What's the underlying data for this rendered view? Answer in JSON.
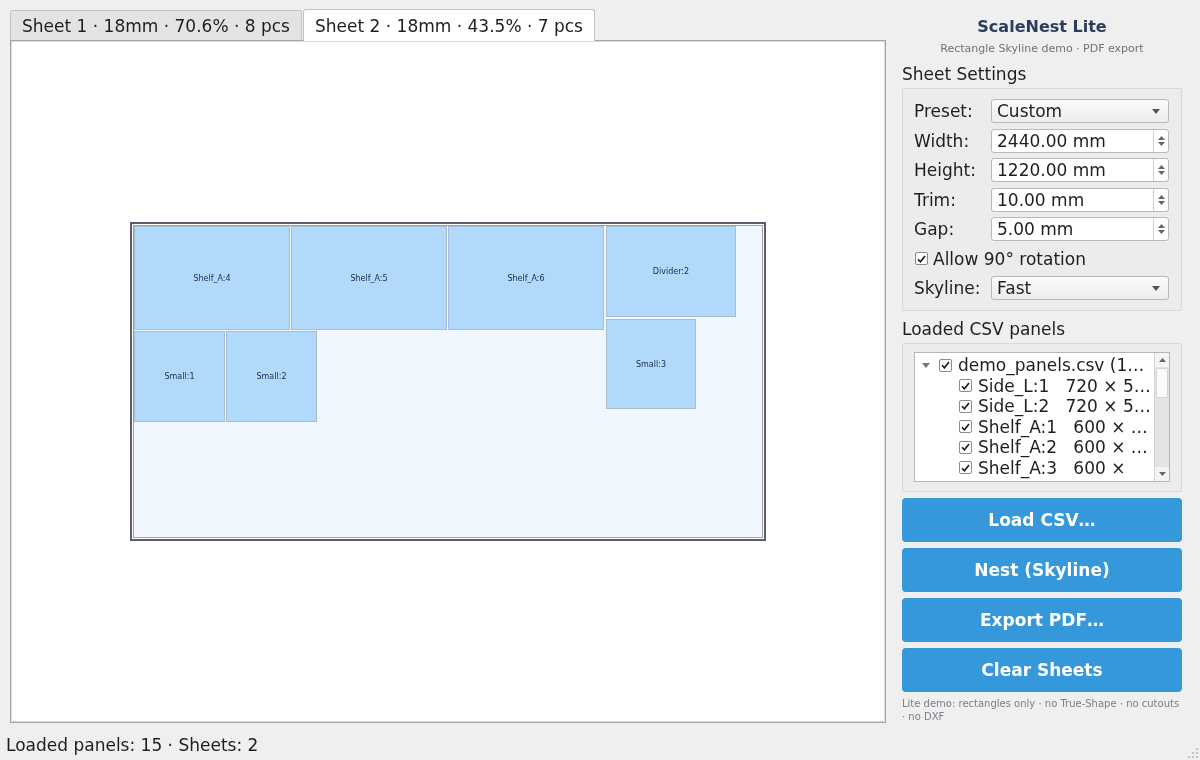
{
  "tabs": [
    {
      "label": "Sheet 1 · 18mm · 70.6% · 8 pcs",
      "selected": false
    },
    {
      "label": "Sheet 2 · 18mm · 43.5% · 7 pcs",
      "selected": true
    }
  ],
  "sheet_view": {
    "pieces": [
      {
        "label": "Shelf_A:4"
      },
      {
        "label": "Shelf_A:5"
      },
      {
        "label": "Shelf_A:6"
      },
      {
        "label": "Divider:2"
      },
      {
        "label": "Small:1"
      },
      {
        "label": "Small:2"
      },
      {
        "label": "Small:3"
      }
    ]
  },
  "header": {
    "title": "ScaleNest Lite",
    "subtitle": "Rectangle Skyline demo · PDF export"
  },
  "sheet_settings": {
    "title": "Sheet Settings",
    "fields": [
      {
        "kind": "dropdown",
        "label": "Preset:",
        "value": "Custom"
      },
      {
        "kind": "spinbox",
        "label": "Width:",
        "value": "2440.00 mm"
      },
      {
        "kind": "spinbox",
        "label": "Height:",
        "value": "1220.00 mm"
      },
      {
        "kind": "spinbox",
        "label": "Trim:",
        "value": "10.00 mm"
      },
      {
        "kind": "spinbox",
        "label": "Gap:",
        "value": "5.00 mm"
      },
      {
        "kind": "checkbox",
        "label": "Allow 90° rotation",
        "checked": true
      },
      {
        "kind": "dropdown",
        "label": "Skyline:",
        "value": "Fast"
      }
    ]
  },
  "csv_panels": {
    "title": "Loaded CSV panels",
    "tree": [
      {
        "label": "demo_panels.csv (1…",
        "checked": true,
        "expanded": true,
        "children": [
          {
            "label": "Side_L:1   720 × 5…",
            "checked": true
          },
          {
            "label": "Side_L:2   720 × 5…",
            "checked": true
          },
          {
            "label": "Shelf_A:1   600 × …",
            "checked": true
          },
          {
            "label": "Shelf_A:2   600 × …",
            "checked": true
          },
          {
            "label": "Shelf_A:3   600 ×",
            "checked": true
          }
        ]
      }
    ]
  },
  "buttons": [
    {
      "label": "Load CSV…"
    },
    {
      "label": "Nest (Skyline)"
    },
    {
      "label": "Export PDF…"
    },
    {
      "label": "Clear Sheets"
    }
  ],
  "footnote": "Lite demo: rectangles only · no True-Shape · no cutouts · no DXF",
  "status_bar": {
    "text": "Loaded panels: 15 · Sheets: 2"
  }
}
